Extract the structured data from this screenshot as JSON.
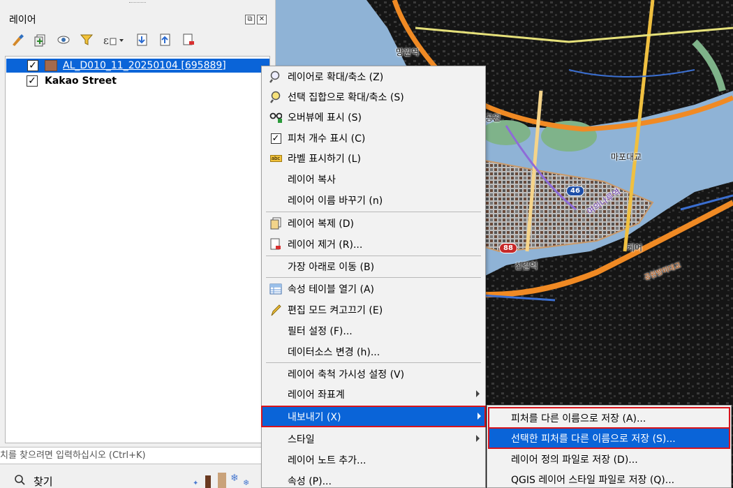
{
  "layer_panel": {
    "title": "레이어",
    "float_icon": "⧉",
    "close_icon": "✕",
    "layers": [
      {
        "name": "AL_D010_11_20250104 [695889]",
        "checked": "✓",
        "selected": true,
        "swatch": "#a46a4c"
      },
      {
        "name": "Kakao Street",
        "checked": "✓",
        "selected": false
      }
    ]
  },
  "locator": {
    "placeholder": "치를 찾으려면 입력하십시오 (Ctrl+K)"
  },
  "browser": {
    "find_label": "찾기"
  },
  "map_labels": [
    "망원역",
    "마포대교",
    "공원",
    "46",
    "88",
    "신길역",
    "케어",
    "여의나루역",
    "공원방미대교"
  ],
  "context_menu": {
    "items": [
      {
        "label": "레이어로 확대/축소 (Z)",
        "icon": "zoom-layer-icon"
      },
      {
        "label": "선택 집합으로 확대/축소 (S)",
        "icon": "zoom-selection-icon"
      },
      {
        "label": "오버뷰에 표시 (S)",
        "icon": "overview-icon"
      },
      {
        "label": "피처 개수 표시 (C)",
        "icon": "checkbox-icon",
        "check": "✓"
      },
      {
        "label": "라벨 표시하기 (L)",
        "icon": "label-icon",
        "badge": "abc"
      },
      {
        "label": "레이어 복사",
        "icon": ""
      },
      {
        "label": "레이어 이름 바꾸기 (n)",
        "icon": ""
      },
      {
        "label": "레이어 복제 (D)",
        "icon": "duplicate-layer-icon"
      },
      {
        "label": "레이어 제거 (R)...",
        "icon": "remove-layer-icon"
      },
      {
        "label": "가장 아래로 이동 (B)",
        "icon": ""
      },
      {
        "label": "속성 테이블 열기 (A)",
        "icon": "attribute-table-icon"
      },
      {
        "label": "편집 모드 켜고끄기 (E)",
        "icon": "pencil-icon"
      },
      {
        "label": "필터 설정 (F)...",
        "icon": ""
      },
      {
        "label": "데이터소스 변경 (h)...",
        "icon": ""
      },
      {
        "label": "레이어 축척 가시성 설정 (V)",
        "icon": ""
      },
      {
        "label": "레이어 좌표계",
        "icon": "",
        "submenu": true
      },
      {
        "label": "내보내기 (X)",
        "icon": "",
        "submenu": true,
        "active": true
      },
      {
        "label": "스타일",
        "icon": "",
        "submenu": true
      },
      {
        "label": "레이어 노트 추가...",
        "icon": ""
      },
      {
        "label": "속성 (P)...",
        "icon": ""
      }
    ]
  },
  "export_submenu": {
    "items": [
      {
        "label": "피처를 다른 이름으로 저장 (A)..."
      },
      {
        "label": "선택한 피처를 다른 이름으로 저장 (S)...",
        "active": true
      },
      {
        "label": "레이어 정의 파일로 저장 (D)..."
      },
      {
        "label": "QGIS 레이어 스타일 파일로 저장 (Q)..."
      }
    ]
  },
  "colors": {
    "selection": "#0a64d8",
    "highlight_outline": "#d8141c",
    "river": "#8fb3d6",
    "arterial": "#f08a24"
  }
}
